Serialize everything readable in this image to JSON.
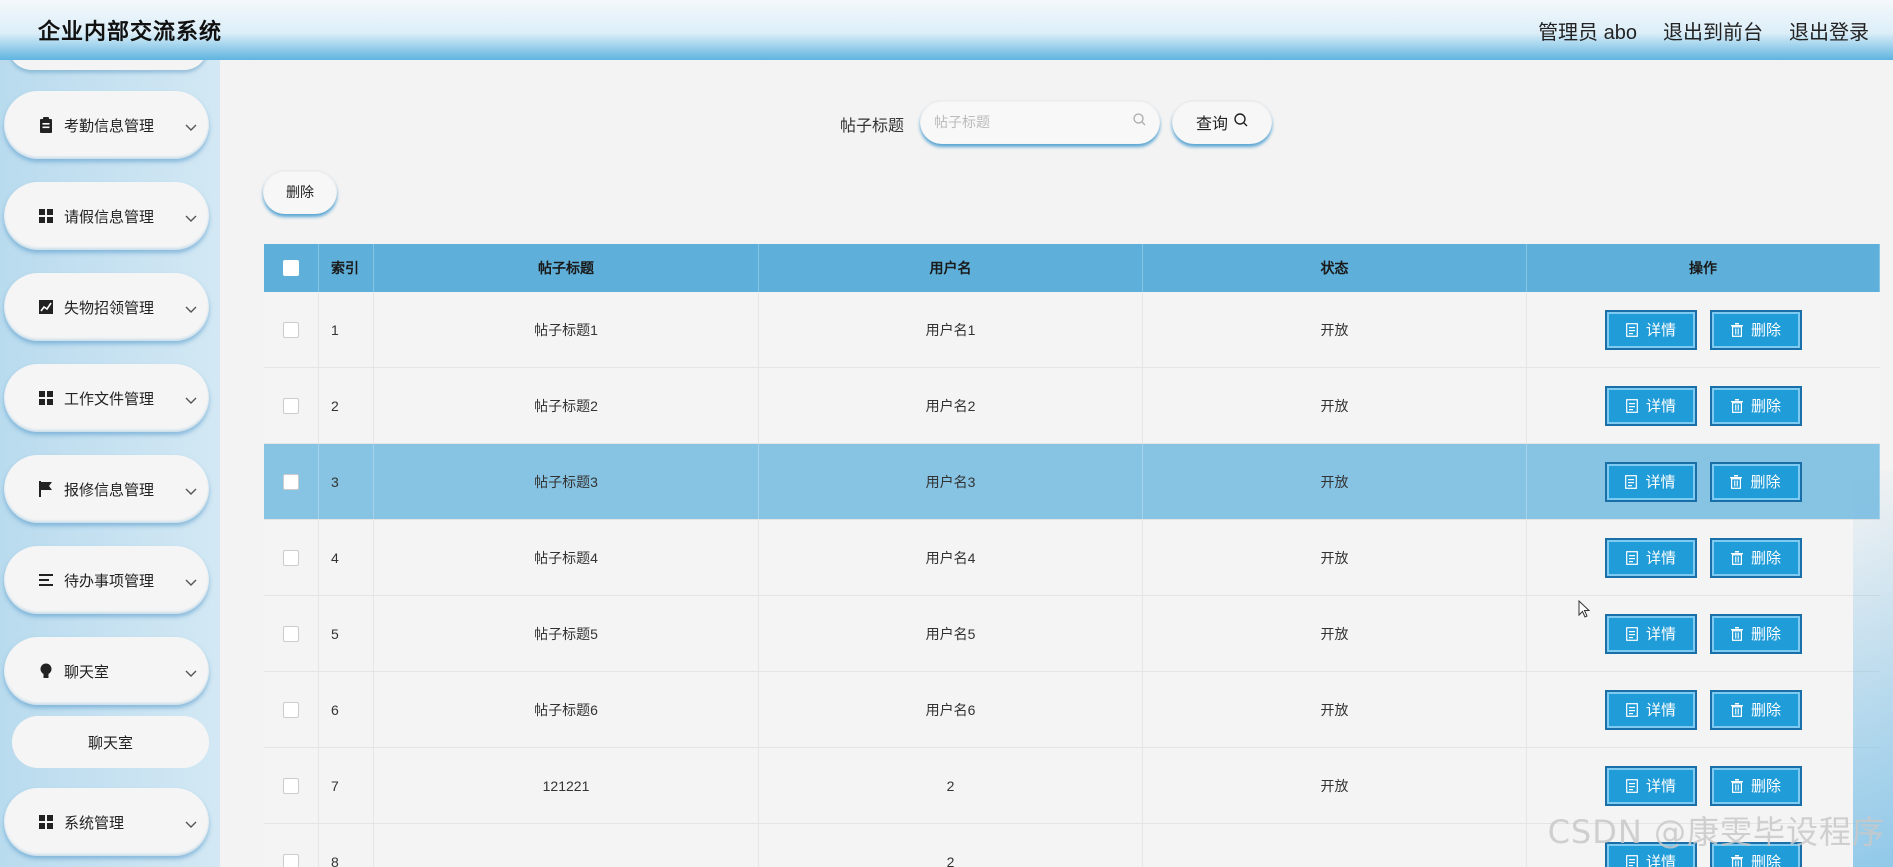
{
  "header": {
    "app_title": "企业内部交流系统",
    "admin_label": "管理员 abo",
    "exit_front_label": "退出到前台",
    "logout_label": "退出登录"
  },
  "sidebar": {
    "items": [
      {
        "label": "考勤信息管理",
        "icon": "clipboard-icon"
      },
      {
        "label": "请假信息管理",
        "icon": "grid-icon"
      },
      {
        "label": "失物招领管理",
        "icon": "chart-icon"
      },
      {
        "label": "工作文件管理",
        "icon": "grid-icon"
      },
      {
        "label": "报修信息管理",
        "icon": "flag-icon"
      },
      {
        "label": "待办事项管理",
        "icon": "list-icon"
      },
      {
        "label": "聊天室",
        "icon": "bulb-icon"
      },
      {
        "label": "系统管理",
        "icon": "grid-icon"
      }
    ],
    "submenu_label": "聊天室"
  },
  "search": {
    "label": "帖子标题",
    "placeholder": "帖子标题",
    "value": "",
    "query_label": "查询"
  },
  "toolbar": {
    "delete_label": "删除"
  },
  "table": {
    "headers": {
      "index": "索引",
      "title": "帖子标题",
      "user": "用户名",
      "status": "状态",
      "ops": "操作"
    },
    "detail_label": "详情",
    "delete_label": "删除",
    "rows": [
      {
        "index": "1",
        "title": "帖子标题1",
        "user": "用户名1",
        "status": "开放"
      },
      {
        "index": "2",
        "title": "帖子标题2",
        "user": "用户名2",
        "status": "开放"
      },
      {
        "index": "3",
        "title": "帖子标题3",
        "user": "用户名3",
        "status": "开放"
      },
      {
        "index": "4",
        "title": "帖子标题4",
        "user": "用户名4",
        "status": "开放"
      },
      {
        "index": "5",
        "title": "帖子标题5",
        "user": "用户名5",
        "status": "开放"
      },
      {
        "index": "6",
        "title": "帖子标题6",
        "user": "用户名6",
        "status": "开放"
      },
      {
        "index": "7",
        "title": "121221",
        "user": "2",
        "status": "开放"
      },
      {
        "index": "8",
        "title": "",
        "user": "2",
        "status": ""
      }
    ],
    "highlighted_row": "3"
  },
  "watermark": "CSDN @康雯毕设程序",
  "colors": {
    "accent": "#209dd8",
    "header_row": "#5eb0da",
    "highlight_row": "#87c3e3"
  }
}
